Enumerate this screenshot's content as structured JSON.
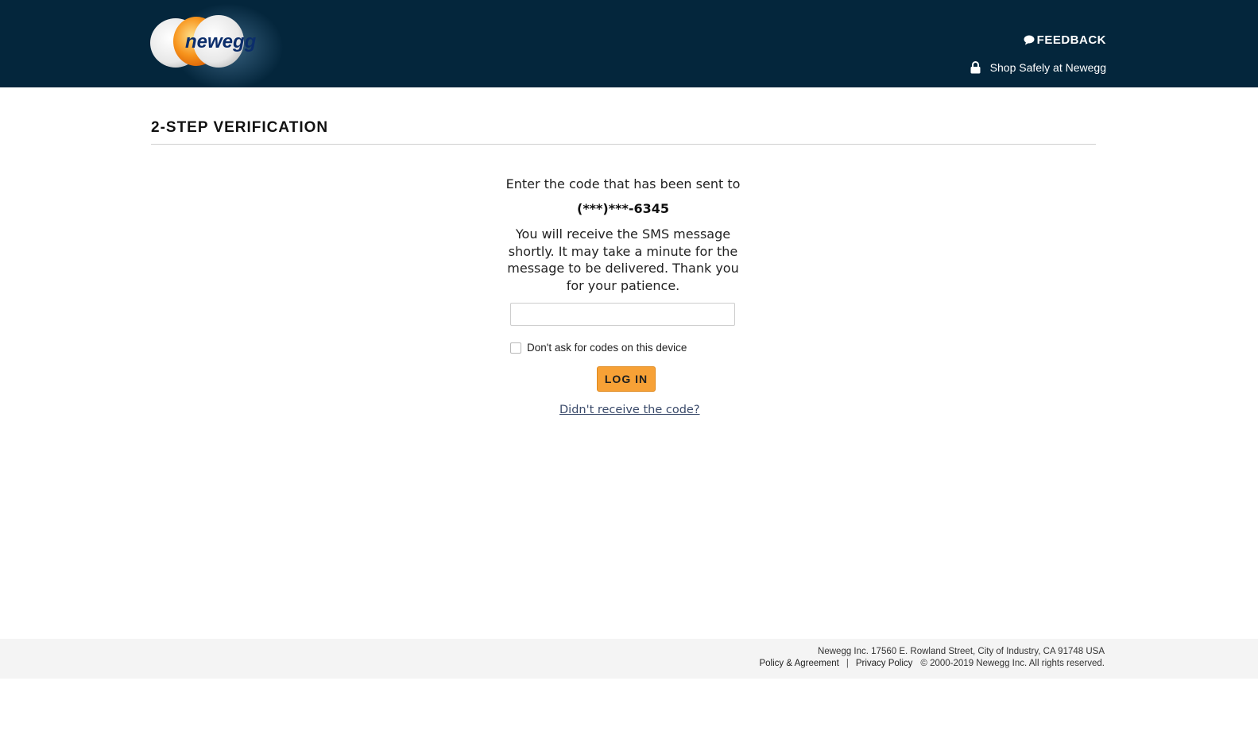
{
  "header": {
    "logo_text": "newegg",
    "feedback_label": "FEEDBACK",
    "shop_safely_label": "Shop Safely at Newegg"
  },
  "page": {
    "title": "2-STEP VERIFICATION"
  },
  "verification": {
    "sent_line": "Enter the code that has been sent to",
    "phone_masked": "(***)***-6345",
    "sms_message": "You will receive the SMS message shortly. It may take a minute for the message to be delivered. Thank you for your patience.",
    "code_value": "",
    "code_placeholder": "",
    "remember_label": "Don't ask for codes on this device",
    "remember_checked": false,
    "login_label": "LOG IN",
    "resend_label": "Didn't receive the code?"
  },
  "footer": {
    "address": "Newegg Inc. 17560 E. Rowland Street, City of Industry, CA 91748 USA",
    "policy_label": "Policy & Agreement",
    "separator": "|",
    "privacy_label": "Privacy Policy",
    "copyright": "© 2000-2019 Newegg Inc.  All rights reserved."
  },
  "colors": {
    "header_bg": "#04263c",
    "button_orange": "#f7a136",
    "footer_bg": "#f4f4f4"
  },
  "icons": {
    "feedback": "speech-bubble-icon",
    "secure": "lock-icon"
  }
}
